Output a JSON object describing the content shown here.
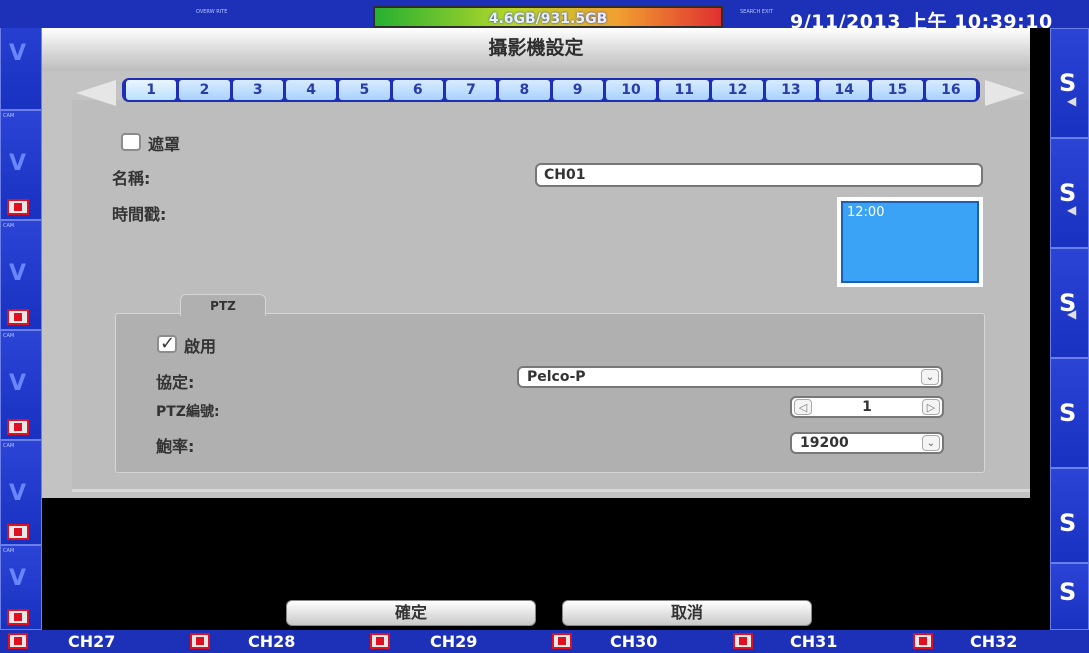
{
  "top_bar": {
    "small_tag_left": "OVERW RITE",
    "storage_text": "4.6GB/931.5GB",
    "small_tag_right": "SEARCH EXIT",
    "datetime": "9/11/2013 上午 10:39:10"
  },
  "dialog": {
    "title": "攝影機設定",
    "tabs": [
      "1",
      "2",
      "3",
      "4",
      "5",
      "6",
      "7",
      "8",
      "9",
      "10",
      "11",
      "12",
      "13",
      "14",
      "15",
      "16"
    ],
    "active_tab": "1",
    "cover_label": "遮罩",
    "name_label": "名稱:",
    "name_value": "CH01",
    "time_label": "時間戳:",
    "time_preview": "12:00",
    "ptz": {
      "group_label": "PTZ",
      "enable_label": "啟用",
      "protocol_label": "協定:",
      "protocol_value": "Pelco-P",
      "id_label": "PTZ編號:",
      "id_value": "1",
      "baud_label": "鮑率:",
      "baud_value": "19200"
    },
    "ok_label": "確定",
    "cancel_label": "取消"
  },
  "channels": [
    "CH27",
    "CH28",
    "CH29",
    "CH30",
    "CH31",
    "CH32"
  ],
  "colors": {
    "background_blue": "#1a2fb0",
    "tab_blue": "#a9d2ff",
    "preview_blue": "#3aa3f5",
    "dialog_gray": "#c3c3c3"
  },
  "icons": {
    "left_arrow": "triangle-left",
    "right_arrow": "triangle-right",
    "record": "film-icon"
  }
}
